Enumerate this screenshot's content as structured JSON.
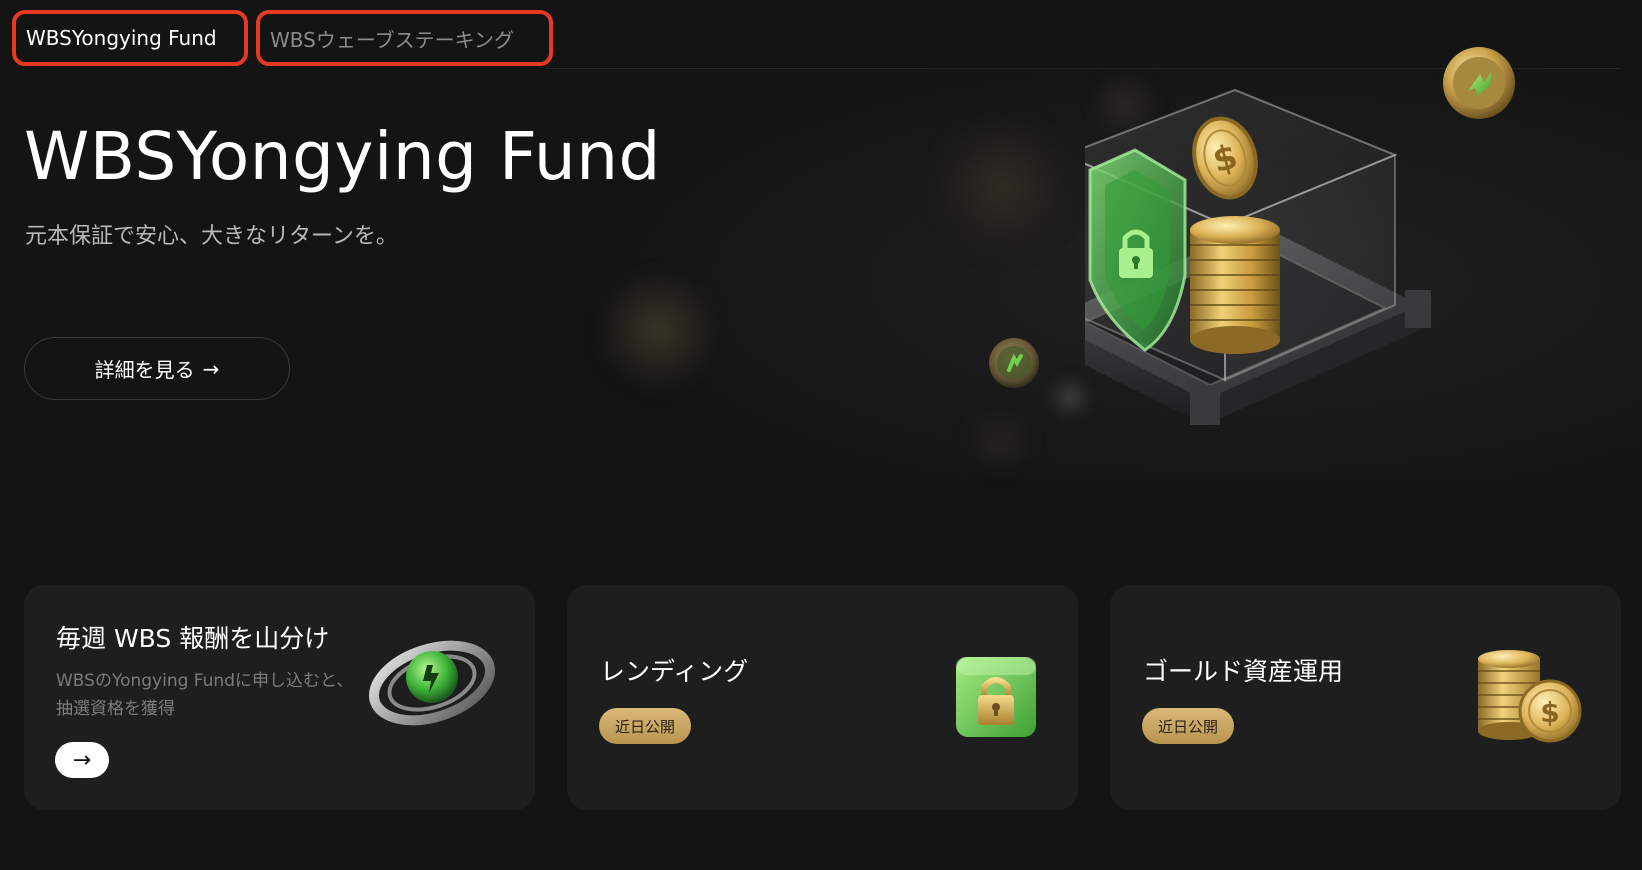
{
  "tabs": [
    {
      "label": "WBSYongying Fund",
      "active": true
    },
    {
      "label": "WBSウェーブステーキング",
      "active": false
    }
  ],
  "hero": {
    "title": "WBSYongying Fund",
    "subtitle": "元本保証で安心、大きなリターンを。",
    "button_label": "詳細を見る",
    "button_arrow": "→"
  },
  "cards": [
    {
      "title": "毎週 WBS 報酬を山分け",
      "description": "WBSのYongying Fundに申し込むと、抽選資格を獲得",
      "arrow": "→",
      "icon": "green-lightning-orb-icon"
    },
    {
      "title": "レンディング",
      "badge": "近日公開",
      "icon": "green-lock-cube-icon"
    },
    {
      "title": "ゴールド資産運用",
      "badge": "近日公開",
      "icon": "gold-coin-stack-icon"
    }
  ],
  "colors": {
    "background": "#141414",
    "card": "#1e1e1e",
    "tab_highlight": "#e83a22",
    "badge_gold": "#d9b97a",
    "accent_green": "#4cc43a"
  }
}
